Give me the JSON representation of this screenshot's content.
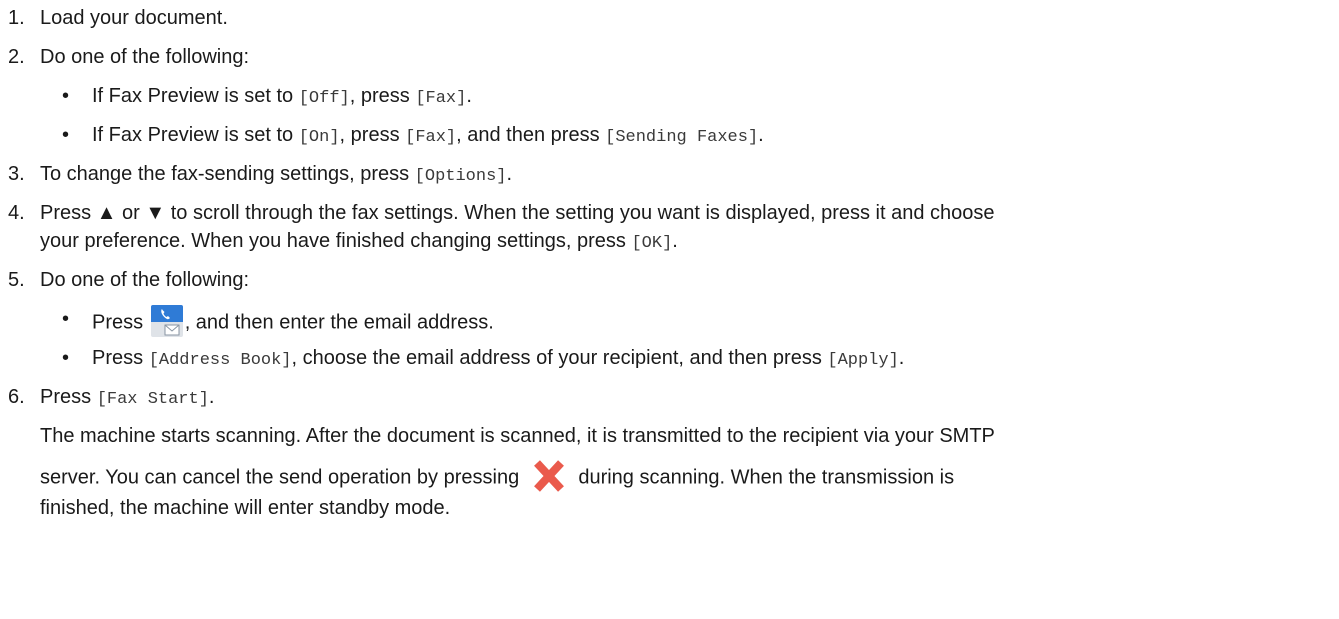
{
  "steps": {
    "s1": {
      "num": "1.",
      "text": "Load your document."
    },
    "s2": {
      "num": "2.",
      "text": "Do one of the following:",
      "b1": {
        "pre": "If Fax Preview is set to ",
        "off": "[Off]",
        "mid": ", press ",
        "fax": "[Fax]",
        "post": "."
      },
      "b2": {
        "pre": "If Fax Preview is set to ",
        "on": "[On]",
        "mid": ", press ",
        "fax": "[Fax]",
        "mid2": ", and then press ",
        "sending": "[Sending Faxes]",
        "post": "."
      }
    },
    "s3": {
      "num": "3.",
      "pre": "To change the fax-sending settings, press ",
      "options": "[Options]",
      "post": "."
    },
    "s4": {
      "num": "4.",
      "line1": "Press ▲ or ▼ to scroll through the fax settings. When the setting you want is displayed, press it and choose",
      "line2_pre": "your preference. When you have finished changing settings, press ",
      "ok": "[OK]",
      "line2_post": "."
    },
    "s5": {
      "num": "5.",
      "text": "Do one of the following:",
      "b1": {
        "pre": "Press ",
        "post": ", and then enter the email address."
      },
      "b2": {
        "pre": "Press ",
        "addr": "[Address Book]",
        "mid": ", choose the email address of your recipient, and then press ",
        "apply": "[Apply]",
        "post": "."
      }
    },
    "s6": {
      "num": "6.",
      "pre": "Press ",
      "start": "[Fax Start]",
      "post": ".",
      "para_l1": "The machine starts scanning. After the document is scanned, it is transmitted to the recipient via your SMTP",
      "para_l2_pre": "server. You can cancel the send operation by pressing ",
      "para_l2_post": " during scanning. When the transmission is",
      "para_l3": "finished, the machine will enter standby mode."
    }
  },
  "bullet_char": "•",
  "icons": {
    "fax_email": "fax-email-icon",
    "stop": "stop-icon"
  },
  "colors": {
    "text": "#1a1a1a",
    "mono_text": "#3a3a3a",
    "fax_icon_blue": "#2f7bd6",
    "fax_icon_bg": "#dfe3e8",
    "stop_red": "#ea5a4c"
  }
}
